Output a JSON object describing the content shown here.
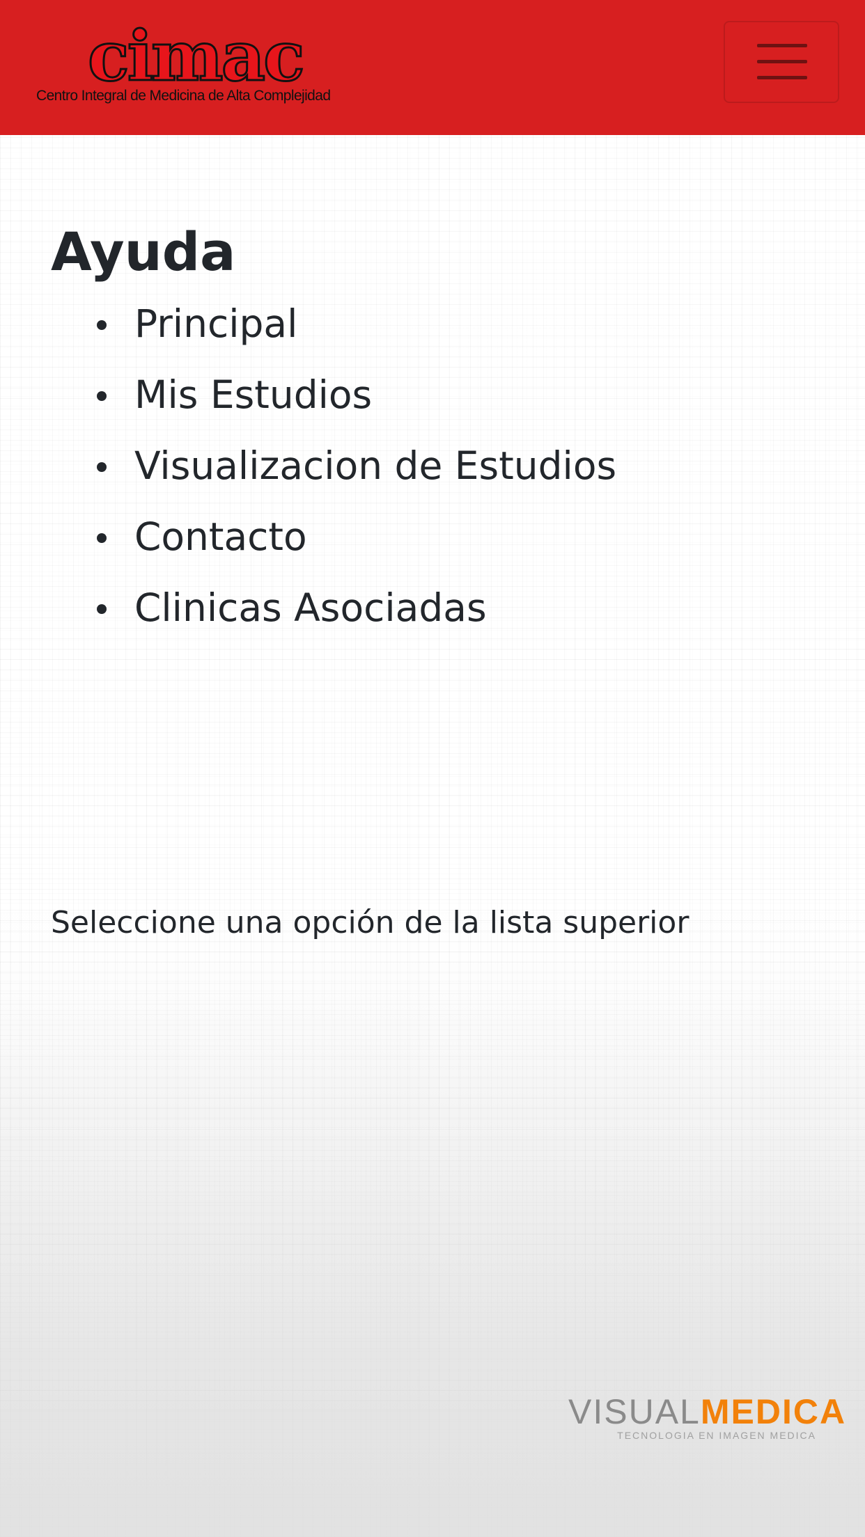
{
  "header": {
    "brand_name": "cimac",
    "brand_tagline": "Centro Integral de Medicina de Alta Complejidad",
    "menu_button_icon": "hamburger-menu-icon",
    "colors": {
      "navbar_bg": "#d71f20",
      "brand_fill": "#e8151b"
    }
  },
  "main": {
    "title": "Ayuda",
    "items": [
      {
        "label": "Principal"
      },
      {
        "label": "Mis Estudios"
      },
      {
        "label": "Visualizacion de Estudios"
      },
      {
        "label": "Contacto"
      },
      {
        "label": "Clinicas Asociadas"
      }
    ],
    "instruction": "Seleccione una opción de la lista superior"
  },
  "footer": {
    "logo_part1": "VISUAL",
    "logo_part2": "MEDICA",
    "logo_tagline": "TECNOLOGIA EN IMAGEN MEDICA",
    "colors": {
      "logo_gray": "#8a8a8a",
      "logo_accent": "#f2810a"
    }
  }
}
